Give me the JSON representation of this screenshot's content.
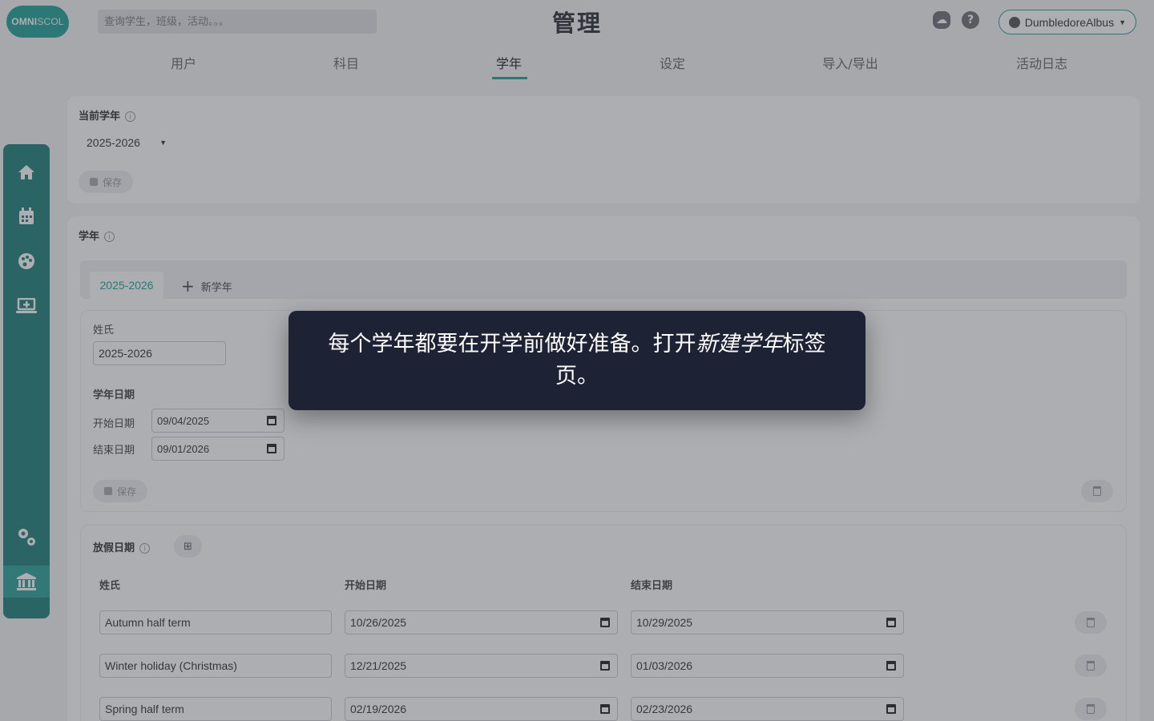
{
  "header": {
    "logo_bold": "OMNI",
    "logo_thin": "SCOL",
    "search_placeholder": "查询学生，班级，活动。。。",
    "title": "管理",
    "help_icon": "?",
    "user_name": "DumbledoreAlbus"
  },
  "tabs": [
    {
      "label": "用户"
    },
    {
      "label": "科目"
    },
    {
      "label": "学年",
      "active": true
    },
    {
      "label": "设定"
    },
    {
      "label": "导入/导出"
    },
    {
      "label": "活动日志"
    }
  ],
  "sidebar": {
    "items": [
      {
        "icon": "home-icon"
      },
      {
        "icon": "calendar-icon"
      },
      {
        "icon": "palette-icon"
      },
      {
        "icon": "monitor-add-icon"
      },
      {
        "icon": "gears-icon"
      },
      {
        "icon": "bank-icon",
        "active": true
      }
    ],
    "accent": "#20807a"
  },
  "current_year": {
    "label": "当前学年",
    "selected": "2025-2026",
    "save_label": "保存"
  },
  "school_year": {
    "label": "学年",
    "year_tab": "2025-2026",
    "new_year_label": "新学年",
    "name_label": "姓氏",
    "name_value": "2025-2026",
    "dates_label": "学年日期",
    "start_label": "开始日期",
    "start_value": "09/04/2025",
    "end_label": "结束日期",
    "end_value": "09/01/2026",
    "save_label": "保存"
  },
  "holidays": {
    "label": "放假日期",
    "columns": [
      "姓氏",
      "开始日期",
      "结束日期"
    ],
    "rows": [
      {
        "name": "Autumn half term",
        "start": "10/26/2025",
        "end": "10/29/2025"
      },
      {
        "name": "Winter holiday (Christmas)",
        "start": "12/21/2025",
        "end": "01/03/2026"
      },
      {
        "name": "Spring half term",
        "start": "02/19/2026",
        "end": "02/23/2026"
      }
    ]
  },
  "tooltip": {
    "text_before": "每个学年都要在开学前做好准备。打开",
    "text_emph": "新建学年",
    "text_after": "标签页。"
  },
  "colors": {
    "accent": "#20a39b",
    "tooltip_bg": "#1e2235"
  }
}
